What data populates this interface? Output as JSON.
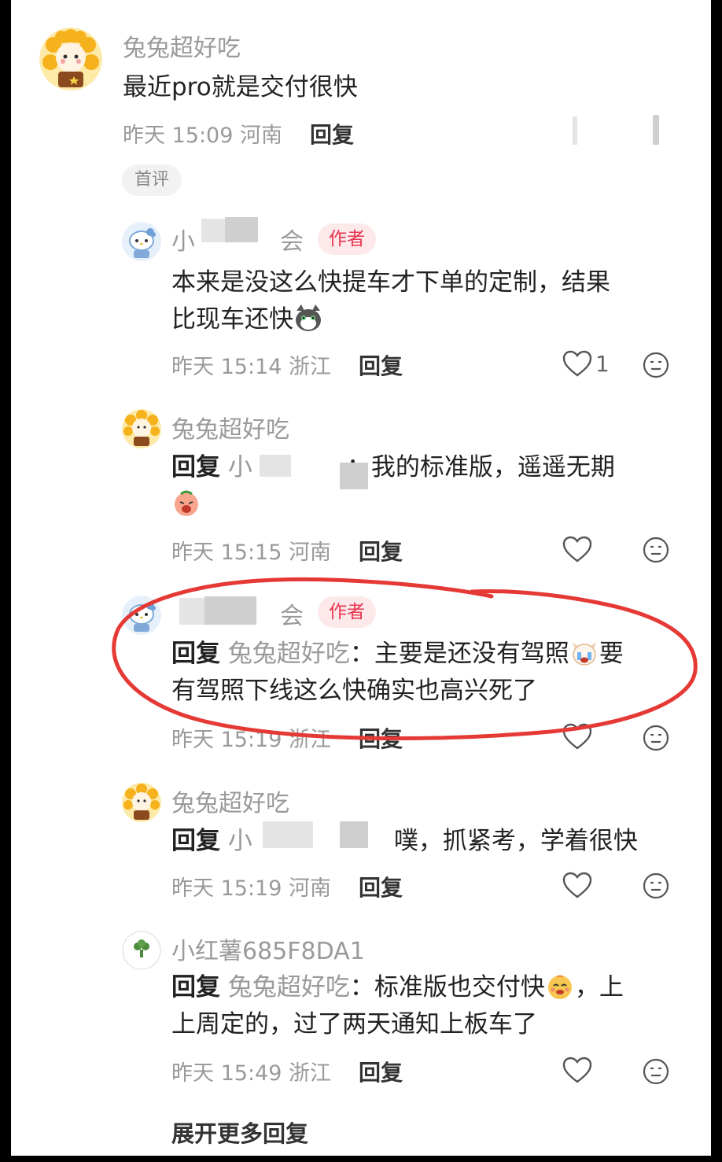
{
  "comment_main": {
    "author": "兔兔超好吃",
    "text": "最近pro就是交付很快",
    "time": "昨天 15:09",
    "location": "河南",
    "reply_label": "回复",
    "badge": "首评"
  },
  "replies": [
    {
      "author_visible_a": "小",
      "author_visible_b": "会",
      "author_tag": "作者",
      "text_line1": "本来是没这么快提车才下单的定制，结果",
      "text_line2": "比现车还快",
      "time": "昨天 15:14",
      "location": "浙江",
      "reply_label": "回复",
      "like_count": "1"
    },
    {
      "author": "兔兔超好吃",
      "reply_prefix": "回复",
      "reply_target": "小",
      "text": "：我的标准版，遥遥无期",
      "time": "昨天 15:15",
      "location": "河南",
      "reply_label": "回复"
    },
    {
      "author_visible_b": "会",
      "author_tag": "作者",
      "reply_prefix": "回复",
      "reply_target": "兔兔超好吃",
      "text_a": "：主要是还没有驾照",
      "text_b": "要",
      "text_line2": "有驾照下线这么快确实也高兴死了",
      "time": "昨天 15:19",
      "location": "浙江",
      "reply_label": "回复"
    },
    {
      "author": "兔兔超好吃",
      "reply_prefix": "回复",
      "reply_target": "小",
      "text": "噗，抓紧考，学着很快",
      "time": "昨天 15:19",
      "location": "河南",
      "reply_label": "回复"
    },
    {
      "author": "小红薯685F8DA1",
      "reply_prefix": "回复",
      "reply_target": "兔兔超好吃",
      "text_a": "：标准版也交付快",
      "text_b": "，上",
      "text_line2": "上周定的，过了两天通知上板车了",
      "time": "昨天 15:49",
      "location": "浙江",
      "reply_label": "回复"
    }
  ],
  "expand_more": "展开更多回复",
  "colors": {
    "author_tag_bg": "#fde8ea",
    "author_tag_text": "#e8354f",
    "highlight_loop": "#e53935"
  }
}
